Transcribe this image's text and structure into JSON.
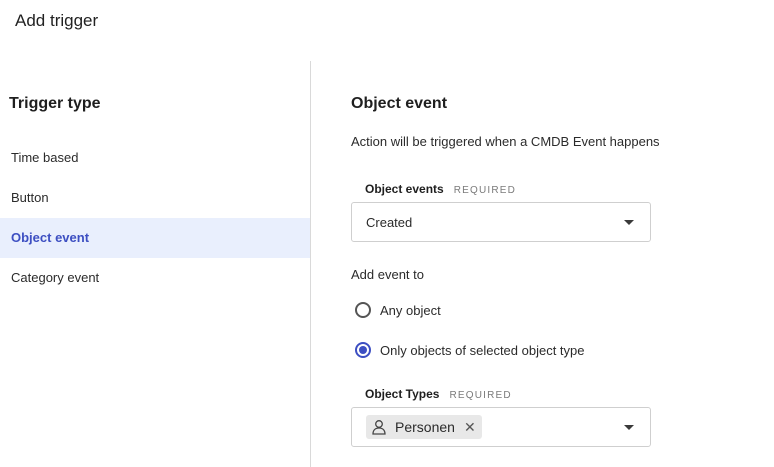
{
  "dialog": {
    "title": "Add trigger"
  },
  "sidebar": {
    "heading": "Trigger type",
    "items": [
      {
        "label": "Time based",
        "active": false
      },
      {
        "label": "Button",
        "active": false
      },
      {
        "label": "Object event",
        "active": true
      },
      {
        "label": "Category event",
        "active": false
      }
    ]
  },
  "main": {
    "title": "Object event",
    "description": "Action will be triggered when a CMDB Event happens",
    "object_events": {
      "label": "Object events",
      "required": "REQUIRED",
      "value": "Created"
    },
    "add_event_to": {
      "label": "Add event to",
      "options": [
        {
          "label": "Any object",
          "checked": false
        },
        {
          "label": "Only objects of selected object type",
          "checked": true
        }
      ]
    },
    "object_types": {
      "label": "Object Types",
      "required": "REQUIRED",
      "chips": [
        {
          "label": "Personen",
          "icon": "person-icon"
        }
      ]
    }
  },
  "colors": {
    "accent": "#3d4fc2",
    "active_bg": "#e9effd",
    "chip_bg": "#e8e8e8"
  }
}
